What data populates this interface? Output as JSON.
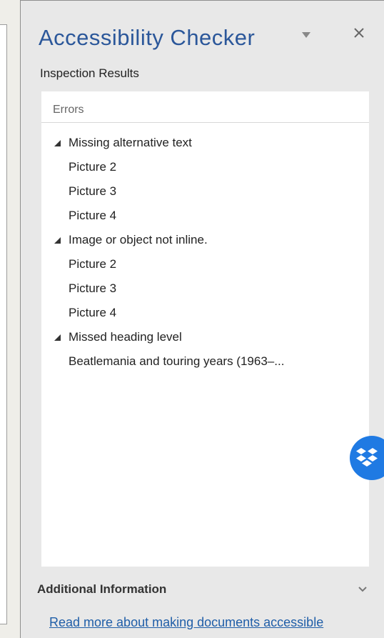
{
  "pane": {
    "title": "Accessibility Checker",
    "dropdown_icon": "triangle-down-icon",
    "close_icon": "close-icon"
  },
  "inspection": {
    "label": "Inspection Results",
    "header": "Errors",
    "groups": [
      {
        "title": "Missing alternative text",
        "items": [
          "Picture 2",
          "Picture 3",
          "Picture 4"
        ]
      },
      {
        "title": "Image or object not inline.",
        "items": [
          "Picture 2",
          "Picture 3",
          "Picture 4"
        ]
      },
      {
        "title": "Missed heading level",
        "items": [
          "Beatlemania and touring years (1963–..."
        ]
      }
    ]
  },
  "additional": {
    "label": "Additional Information",
    "link": "Read more about making documents accessible"
  },
  "colors": {
    "title": "#2b579a",
    "link": "#1f5ea8",
    "dropbox": "#1f7ae3"
  }
}
